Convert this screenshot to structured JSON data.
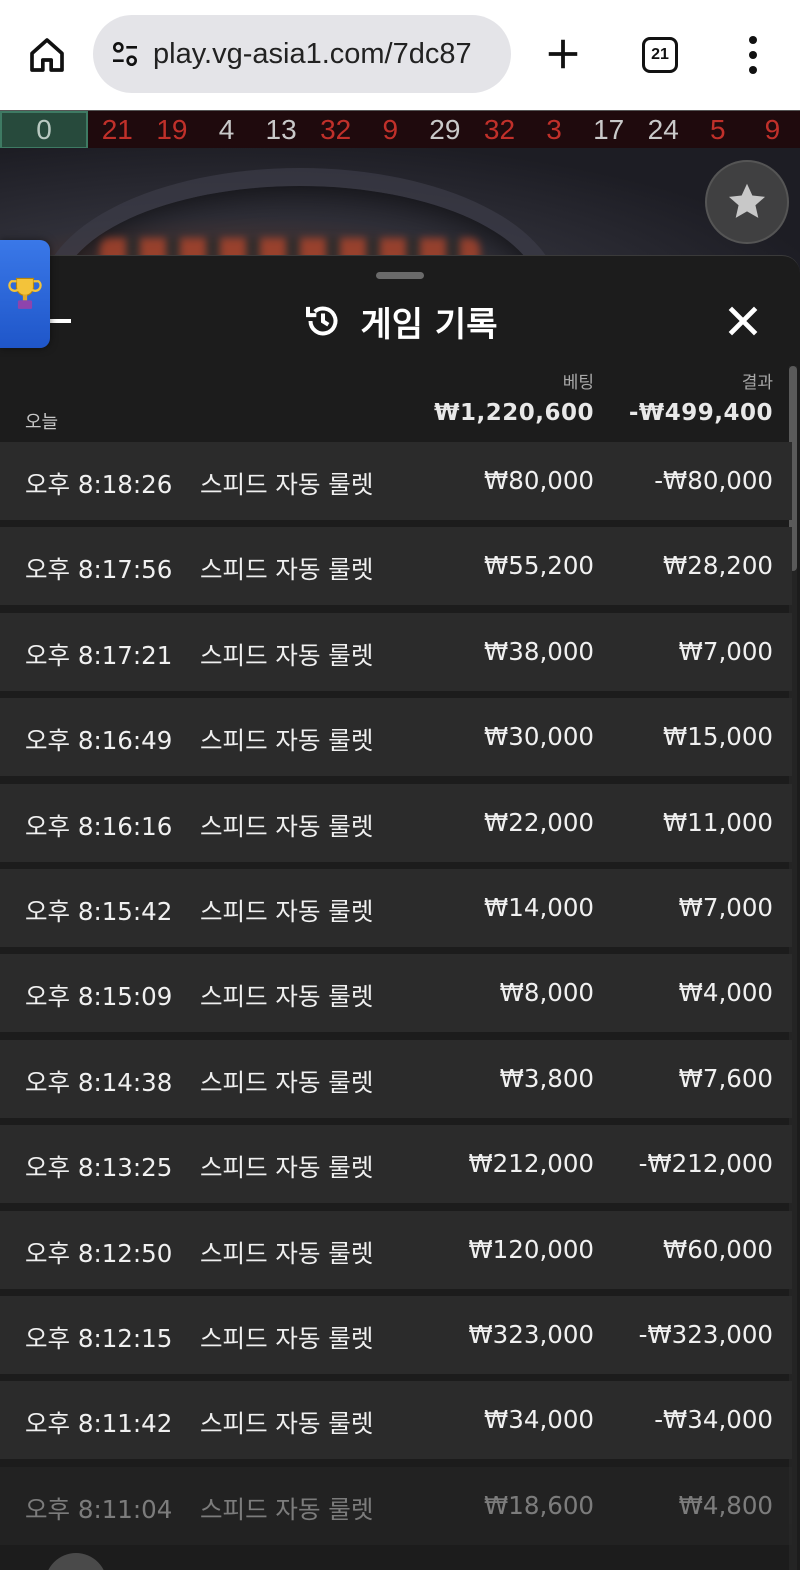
{
  "browser": {
    "url": "play.vg-asia1.com/7dc87",
    "tab_count": "21"
  },
  "results_strip": {
    "zero": "0",
    "numbers": [
      {
        "value": "21",
        "color": "red"
      },
      {
        "value": "19",
        "color": "red"
      },
      {
        "value": "4",
        "color": "black"
      },
      {
        "value": "13",
        "color": "black"
      },
      {
        "value": "32",
        "color": "red"
      },
      {
        "value": "9",
        "color": "red"
      },
      {
        "value": "29",
        "color": "black"
      },
      {
        "value": "32",
        "color": "red"
      },
      {
        "value": "3",
        "color": "red"
      },
      {
        "value": "17",
        "color": "black"
      },
      {
        "value": "24",
        "color": "black"
      },
      {
        "value": "5",
        "color": "red"
      },
      {
        "value": "9",
        "color": "red"
      }
    ],
    "colors": {
      "red": "#c0302a",
      "black": "#c9c9c9"
    }
  },
  "panel": {
    "title": "게임 기록",
    "col_bet": "베팅",
    "col_result": "결과",
    "today": {
      "label": "오늘",
      "bet": "₩1,220,600",
      "result": "-₩499,400"
    },
    "rows": [
      {
        "time": "오후 8:18:26",
        "game": "스피드 자동 룰렛",
        "bet": "₩80,000",
        "result": "-₩80,000"
      },
      {
        "time": "오후 8:17:56",
        "game": "스피드 자동 룰렛",
        "bet": "₩55,200",
        "result": "₩28,200"
      },
      {
        "time": "오후 8:17:21",
        "game": "스피드 자동 룰렛",
        "bet": "₩38,000",
        "result": "₩7,000"
      },
      {
        "time": "오후 8:16:49",
        "game": "스피드 자동 룰렛",
        "bet": "₩30,000",
        "result": "₩15,000"
      },
      {
        "time": "오후 8:16:16",
        "game": "스피드 자동 룰렛",
        "bet": "₩22,000",
        "result": "₩11,000"
      },
      {
        "time": "오후 8:15:42",
        "game": "스피드 자동 룰렛",
        "bet": "₩14,000",
        "result": "₩7,000"
      },
      {
        "time": "오후 8:15:09",
        "game": "스피드 자동 룰렛",
        "bet": "₩8,000",
        "result": "₩4,000"
      },
      {
        "time": "오후 8:14:38",
        "game": "스피드 자동 룰렛",
        "bet": "₩3,800",
        "result": "₩7,600"
      },
      {
        "time": "오후 8:13:25",
        "game": "스피드 자동 룰렛",
        "bet": "₩212,000",
        "result": "-₩212,000"
      },
      {
        "time": "오후 8:12:50",
        "game": "스피드 자동 룰렛",
        "bet": "₩120,000",
        "result": "₩60,000"
      },
      {
        "time": "오후 8:12:15",
        "game": "스피드 자동 룰렛",
        "bet": "₩323,000",
        "result": "-₩323,000"
      },
      {
        "time": "오후 8:11:42",
        "game": "스피드 자동 룰렛",
        "bet": "₩34,000",
        "result": "-₩34,000"
      },
      {
        "time": "오후 8:11:04",
        "game": "스피드 자동 룰렛",
        "bet": "₩18,600",
        "result": "₩4,800"
      }
    ]
  },
  "icons": {
    "home": "home-icon",
    "site_settings": "tune-icon",
    "new_tab": "plus-icon",
    "tabs": "tab-count-icon",
    "menu": "more-vert-icon",
    "favorite": "star-icon",
    "back": "arrow-left-icon",
    "history": "history-icon",
    "close": "close-icon",
    "trophy": "trophy-icon"
  }
}
